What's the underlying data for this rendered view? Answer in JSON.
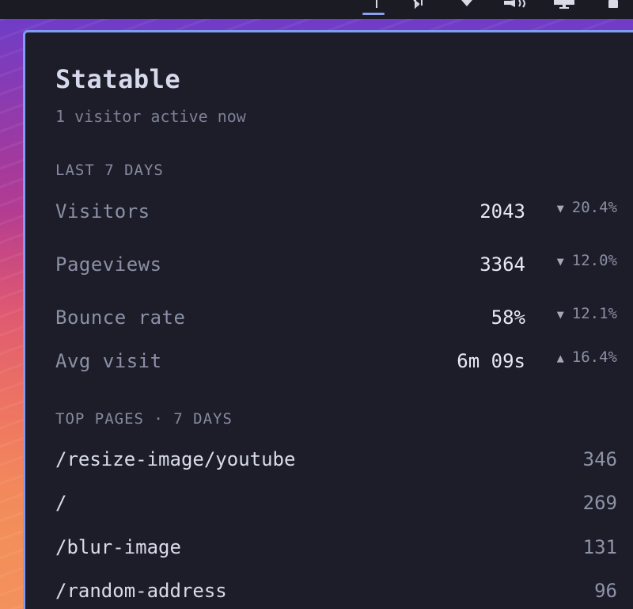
{
  "tray": {
    "icons": [
      "input-icon",
      "bluetooth-icon",
      "wifi-icon",
      "volume-icon",
      "display-icon",
      "battery-icon"
    ]
  },
  "colors": {
    "panel_bg": "#1c1d28",
    "panel_border": "#7f9cf2",
    "accent": "#8aa0f0"
  },
  "app": {
    "title": "Statable",
    "active_visitors": "1 visitor active now"
  },
  "stats": {
    "section_label": "LAST 7 DAYS",
    "rows": [
      {
        "label": "Visitors",
        "value": "2043",
        "direction": "down",
        "arrow": "▼",
        "change": "20.4%"
      },
      {
        "label": "Pageviews",
        "value": "3364",
        "direction": "down",
        "arrow": "▼",
        "change": "12.0%"
      },
      {
        "label": "Bounce rate",
        "value": "58%",
        "direction": "down",
        "arrow": "▼",
        "change": "12.1%"
      },
      {
        "label": "Avg visit",
        "value": "6m 09s",
        "direction": "up",
        "arrow": "▲",
        "change": "16.4%"
      }
    ]
  },
  "top_pages": {
    "section_label": "TOP PAGES · 7 DAYS",
    "rows": [
      {
        "path": "/resize-image/youtube",
        "count": "346"
      },
      {
        "path": "/",
        "count": "269"
      },
      {
        "path": "/blur-image",
        "count": "131"
      },
      {
        "path": "/random-address",
        "count": "96"
      }
    ]
  }
}
